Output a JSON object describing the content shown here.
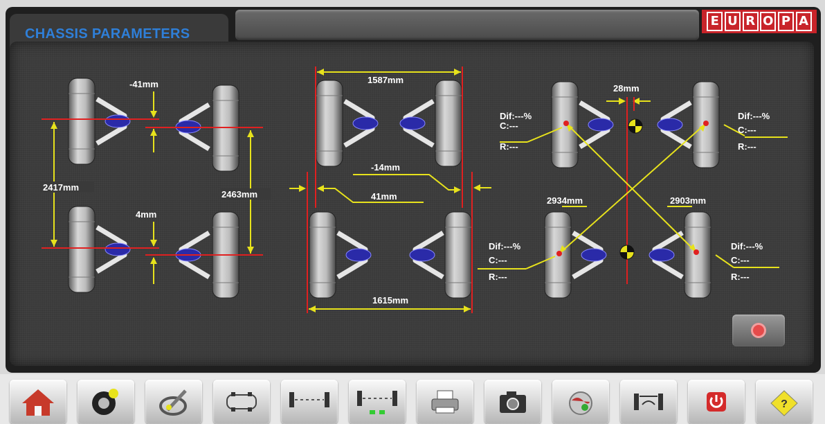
{
  "header": {
    "title": "CHASSIS PARAMETERS",
    "logo_letters": [
      "E",
      "U",
      "R",
      "O",
      "P",
      "A"
    ],
    "logo_color": "#c8242a",
    "title_color": "#2f7fd8"
  },
  "measurements": {
    "left_view": {
      "front_offset": "-41mm",
      "rear_offset": "4mm",
      "left_wheelbase": "2417mm",
      "right_wheelbase": "2463mm"
    },
    "center_view": {
      "front_track": "1587mm",
      "front_offset": "-14mm",
      "rear_offset": "41mm",
      "rear_track": "1615mm"
    },
    "right_view": {
      "axle_offset": "28mm",
      "diagonal_left": "2934mm",
      "diagonal_right": "2903mm",
      "front_left": {
        "dif": "Dif:---%",
        "c": "C:---",
        "r": "R:---"
      },
      "front_right": {
        "dif": "Dif:---%",
        "c": "C:---",
        "r": "R:---"
      },
      "rear_left": {
        "dif": "Dif:---%",
        "c": "C:---",
        "r": "R:---"
      },
      "rear_right": {
        "dif": "Dif:---%",
        "c": "C:---",
        "r": "R:---"
      }
    }
  },
  "colors": {
    "dimension_line": "#e7e21c",
    "reference_line": "#e02020",
    "sensor": "#2a2aa8"
  },
  "toolbar": [
    {
      "icon": "home-icon"
    },
    {
      "icon": "tire-icon"
    },
    {
      "icon": "steering-wrench-icon"
    },
    {
      "icon": "car-top-icon"
    },
    {
      "icon": "axle-front-icon"
    },
    {
      "icon": "axle-rear-icon"
    },
    {
      "icon": "printer-icon"
    },
    {
      "icon": "camera-icon"
    },
    {
      "icon": "globe-icon"
    },
    {
      "icon": "track-width-icon"
    },
    {
      "icon": "power-icon"
    },
    {
      "icon": "help-icon"
    }
  ]
}
